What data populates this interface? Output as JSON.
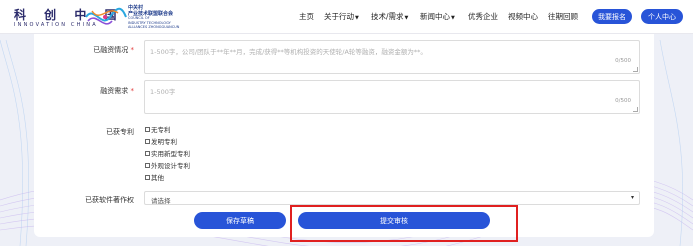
{
  "header": {
    "logo_cn": "科 创 中 国",
    "logo_en": "INNOVATION CHINA",
    "org_lines": [
      "中关村",
      "产业技术联盟联合会"
    ],
    "org_en_lines": [
      "COUNCIL OF",
      "INDUSTRY TECHNOLOGY",
      "ALLIANCES ZHONGGUANCUN"
    ],
    "nav": [
      {
        "label": "主页",
        "has_caret": false
      },
      {
        "label": "关于行动",
        "has_caret": true
      },
      {
        "label": "技术/需求",
        "has_caret": true
      },
      {
        "label": "新闻中心",
        "has_caret": true
      },
      {
        "label": "优秀企业",
        "has_caret": false
      },
      {
        "label": "视频中心",
        "has_caret": false
      },
      {
        "label": "往期回顾",
        "has_caret": false
      }
    ],
    "caret": "▼",
    "register_label": "我要报名",
    "personal_label": "个人中心",
    "accent": "#2854d8"
  },
  "form": {
    "financing_status": {
      "label": "已融资情况",
      "required_mark": "*",
      "placeholder": "1-500字，公司/团队于**年**月，完成/获得**等机构投资的天使轮/A轮等融资，融资金额为**。",
      "counter": "0/500"
    },
    "financing_need": {
      "label": "融资需求",
      "required_mark": "*",
      "placeholder": "1-500字",
      "counter": "0/500"
    },
    "patents": {
      "label": "已获专利",
      "options": [
        "无专利",
        "发明专利",
        "实用新型专利",
        "外观设计专利",
        "其他"
      ]
    },
    "software_copyright": {
      "label": "已获软件著作权",
      "value": "请选择",
      "arrow": "▾"
    },
    "save_draft_label": "保存草稿",
    "submit_label": "提交审核",
    "highlight_color": "#e02020"
  }
}
